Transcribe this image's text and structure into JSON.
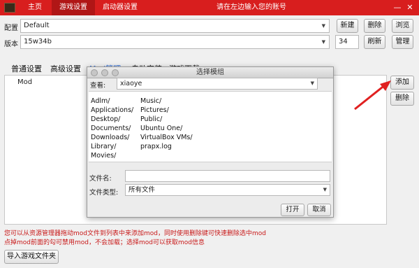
{
  "titlebar": {
    "tabs": [
      {
        "label": "主页"
      },
      {
        "label": "游戏设置"
      },
      {
        "label": "启动器设置"
      }
    ],
    "message": "请在左边输入您的账号",
    "minimize": "—",
    "close": "✕"
  },
  "config": {
    "label": "配置",
    "value": "Default",
    "buttons": {
      "new": "新建",
      "delete": "删除",
      "browse": "浏览"
    }
  },
  "version": {
    "label": "版本",
    "value": "15w34b",
    "number": "34",
    "buttons": {
      "refresh": "刷新",
      "manage": "管理"
    }
  },
  "subtabs": [
    {
      "label": "普通设置"
    },
    {
      "label": "高级设置"
    },
    {
      "label": "Mod管理"
    },
    {
      "label": "自动安装"
    },
    {
      "label": "游戏下载"
    }
  ],
  "mod_panel": {
    "header": "Mod",
    "add_button": "添加",
    "remove_button": "删除"
  },
  "hints": [
    "您可以从资源管理器拖动mod文件到列表中来添加mod，同时使用删除键可快速删除选中mod",
    "点掉mod前面的勾可禁用mod，不会加载；选择mod可以获取mod信息"
  ],
  "import_button": "导入游戏文件夹",
  "dialog": {
    "title": "选择模组",
    "look_in_label": "查看:",
    "look_in_value": "xiaoye",
    "files_col1": [
      "Adlm/",
      "Applications/",
      "Desktop/",
      "Documents/",
      "Downloads/",
      "Library/",
      "Movies/"
    ],
    "files_col2": [
      "Music/",
      "Pictures/",
      "Public/",
      "Ubuntu One/",
      "VirtualBox VMs/",
      "prapx.log"
    ],
    "filename_label": "文件名:",
    "filename_value": "",
    "filetype_label": "文件类型:",
    "filetype_value": "所有文件",
    "open_button": "打开",
    "cancel_button": "取消"
  },
  "colors": {
    "titlebar": "#d81e1e",
    "active_tab": "#b01616",
    "hint_text": "#c81818",
    "annotation_arrow": "#e02020",
    "active_subtab": "#2a6ad8"
  }
}
